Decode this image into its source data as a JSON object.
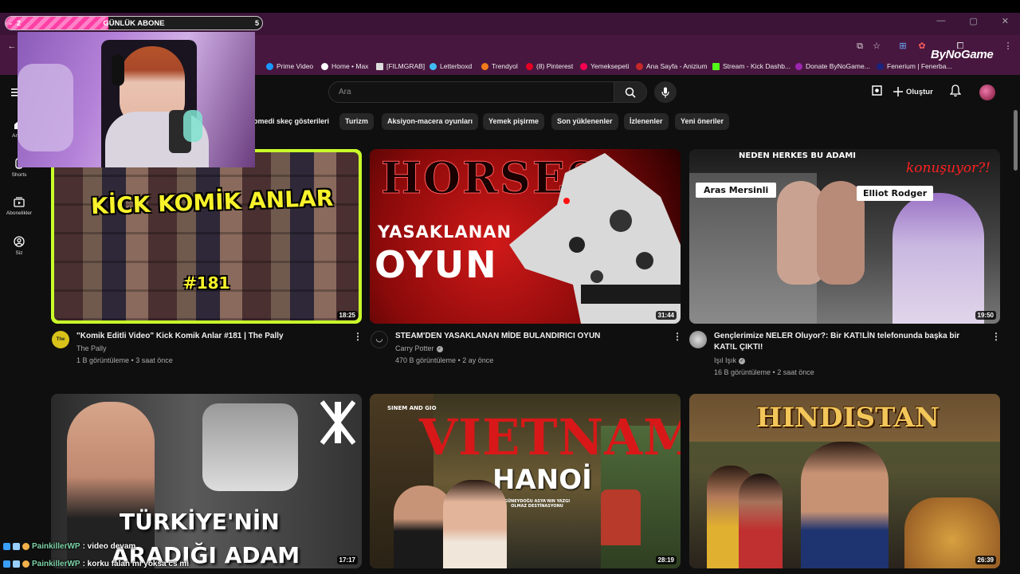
{
  "overlay": {
    "current": "2",
    "title": "GÜNLÜK ABONE",
    "goal": "5",
    "progress_fraction": 0.4
  },
  "browser": {
    "bookmarks": [
      {
        "label": "Prime Video",
        "color": "#1a98ff"
      },
      {
        "label": "Home • Max",
        "color": "#ffffff"
      },
      {
        "label": "[FILMGRAB]",
        "color": "#dddddd"
      },
      {
        "label": "Letterboxd",
        "color": "#40bcf4"
      },
      {
        "label": "Trendyol",
        "color": "#f27a1a"
      },
      {
        "label": "(8) Pinterest",
        "color": "#e60023"
      },
      {
        "label": "Yemeksepeti",
        "color": "#fa0050"
      },
      {
        "label": "Ana Sayfa - Anizium",
        "color": "#c62828"
      },
      {
        "label": "Stream - Kick Dashb...",
        "color": "#53fc18"
      },
      {
        "label": "Donate ByNoGame...",
        "color": "#9c27b0"
      },
      {
        "label": "Fenerium | Fenerba...",
        "color": "#1a237e"
      }
    ],
    "logo": "ByNoGame"
  },
  "header": {
    "search_placeholder": "Ara",
    "create_label": "Oluştur"
  },
  "nav": [
    {
      "label": "Ana S",
      "icon": "home-icon"
    },
    {
      "label": "Shorts",
      "icon": "shorts-icon"
    },
    {
      "label": "Abonelikler",
      "icon": "subscriptions-icon"
    },
    {
      "label": "Siz",
      "icon": "profile-icon"
    }
  ],
  "chips": [
    "omedi skeç gösterileri",
    "Turizm",
    "Aksiyon-macera oyunları",
    "Yemek pişirme",
    "Son yüklenenler",
    "İzlenenler",
    "Yeni öneriler"
  ],
  "videos": [
    {
      "title": "\"Komik Editli Video\" Kick Komik Anlar #181 | The Pally",
      "channel": "The Pally",
      "meta": "1 B görüntüleme • 3 saat önce",
      "duration": "18:25",
      "thumb_text": "KİCK KOMİK ANLAR",
      "thumb_sub": "#181",
      "avatar_text": "The Pally"
    },
    {
      "title": "STEAM'DEN YASAKLANAN MİDE BULANDIRICI OYUN",
      "channel": "Carry Potter",
      "meta": "470 B görüntüleme • 2 ay önce",
      "duration": "31:44",
      "thumb_text": "YASAKLANAN",
      "thumb_sub": "OYUN",
      "thumb_top": "HORSES"
    },
    {
      "title": "Gençlerimize NELER Oluyor?: Bir KAT!LİN telefonunda başka bir KAT!L ÇIKTI!",
      "channel": "Işıl Işık",
      "meta": "16 B görüntüleme • 2 saat önce",
      "duration": "19:50",
      "thumb_text": "NEDEN HERKES BU ADAMI",
      "thumb_sub": "konuşuyor?!",
      "label_left": "Aras Mersinli",
      "label_right": "Elliot Rodger"
    },
    {
      "duration": "17:17",
      "thumb_text": "TÜRKİYE'NİN",
      "thumb_sub": "ARADIĞI ADAM"
    },
    {
      "duration": "28:19",
      "thumb_text": "VIETNAM",
      "thumb_sub": "HANOİ",
      "thumb_top": "SINEM AND GIO",
      "thumb_small": "GÜNEYDOĞU ASYA'NIN YAZGI OLMAZ DESTİNASYONU"
    },
    {
      "duration": "26:39",
      "thumb_text": "HINDISTAN"
    }
  ],
  "chat": [
    {
      "user": "PainkillerWP",
      "message": ": video devam"
    },
    {
      "user": "PainkillerWP",
      "message": ": korku falan mı yoksa cs mi"
    }
  ]
}
